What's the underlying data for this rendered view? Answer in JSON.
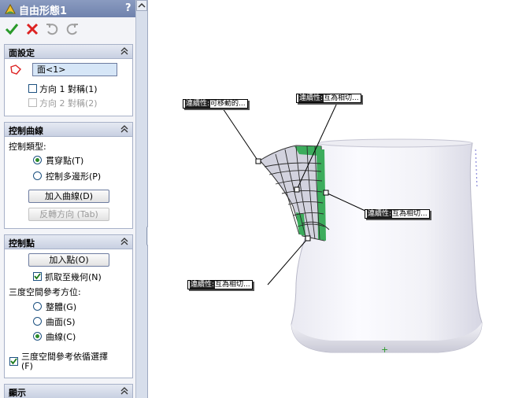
{
  "panel": {
    "title": "自由形態1",
    "help_label": "?",
    "actions": [
      "ok-icon",
      "cancel-icon",
      "undo-icon",
      "redo-icon"
    ],
    "face_settings": {
      "header": "面設定",
      "face_value": "面<1>",
      "dir1_label": "方向 1 對稱(1)",
      "dir2_label": "方向 2 對稱(2)"
    },
    "control_curves": {
      "header": "控制曲線",
      "type_label": "控制類型:",
      "opt_through_points": "貫穿點(T)",
      "opt_control_polygon": "控制多邊形(P)",
      "add_curve_button": "加入曲線(D)",
      "flip_dir_button": "反轉方向 (Tab)"
    },
    "control_points": {
      "header": "控制點",
      "add_point_button": "加入點(O)",
      "snap_label": "抓取至幾何(N)",
      "triad_label": "三度空間參考方位:",
      "opt_global": "整體(G)",
      "opt_surface": "曲面(S)",
      "opt_curve": "曲線(C)",
      "follow_sel_label": "三度空間參考依循選擇",
      "follow_sel_key": "(F)"
    },
    "display": {
      "header": "顯示"
    }
  },
  "viewport": {
    "callouts": [
      {
        "key": "連續性:",
        "value": "可移動的..."
      },
      {
        "key": "連續性:",
        "value": "互為相切..."
      },
      {
        "key": "連續性:",
        "value": "互為相切..."
      },
      {
        "key": "連續性:",
        "value": "互為相切..."
      }
    ],
    "colors": {
      "surface_patch": "#4cb86a",
      "panel_bg": "#f3f4f8",
      "header_bg": "#c8d0e2"
    }
  }
}
